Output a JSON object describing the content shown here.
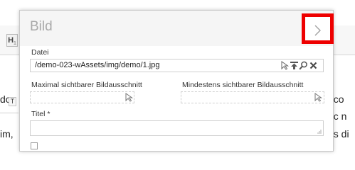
{
  "background": {
    "toolbar_h_icon_letter": "H",
    "toolbar_h_icon_sub": "1",
    "t_icon_letter": "T",
    "left_text": [
      "do",
      "im,"
    ],
    "right_text": [
      "t co",
      "ec n",
      "es di"
    ]
  },
  "dialog": {
    "title": "Bild",
    "close_icon": "chevron-right-icon",
    "file": {
      "label": "Datei",
      "value": "/demo-023-wAssets/img/demo/1.jpg",
      "icons": [
        "cursor-icon",
        "upload-icon",
        "search-icon",
        "clear-icon"
      ]
    },
    "max_crop": {
      "label": "Maximal sichtbarer Bildausschnitt",
      "icon": "cursor-icon"
    },
    "min_crop": {
      "label": "Mindestens sichtbarer Bildausschnitt",
      "icon": "cursor-icon"
    },
    "title_field": {
      "label": "Titel *",
      "value": ""
    }
  },
  "colors": {
    "highlight": "#ee0000",
    "title": "#a9a9a9",
    "border": "#cfcfcf"
  }
}
